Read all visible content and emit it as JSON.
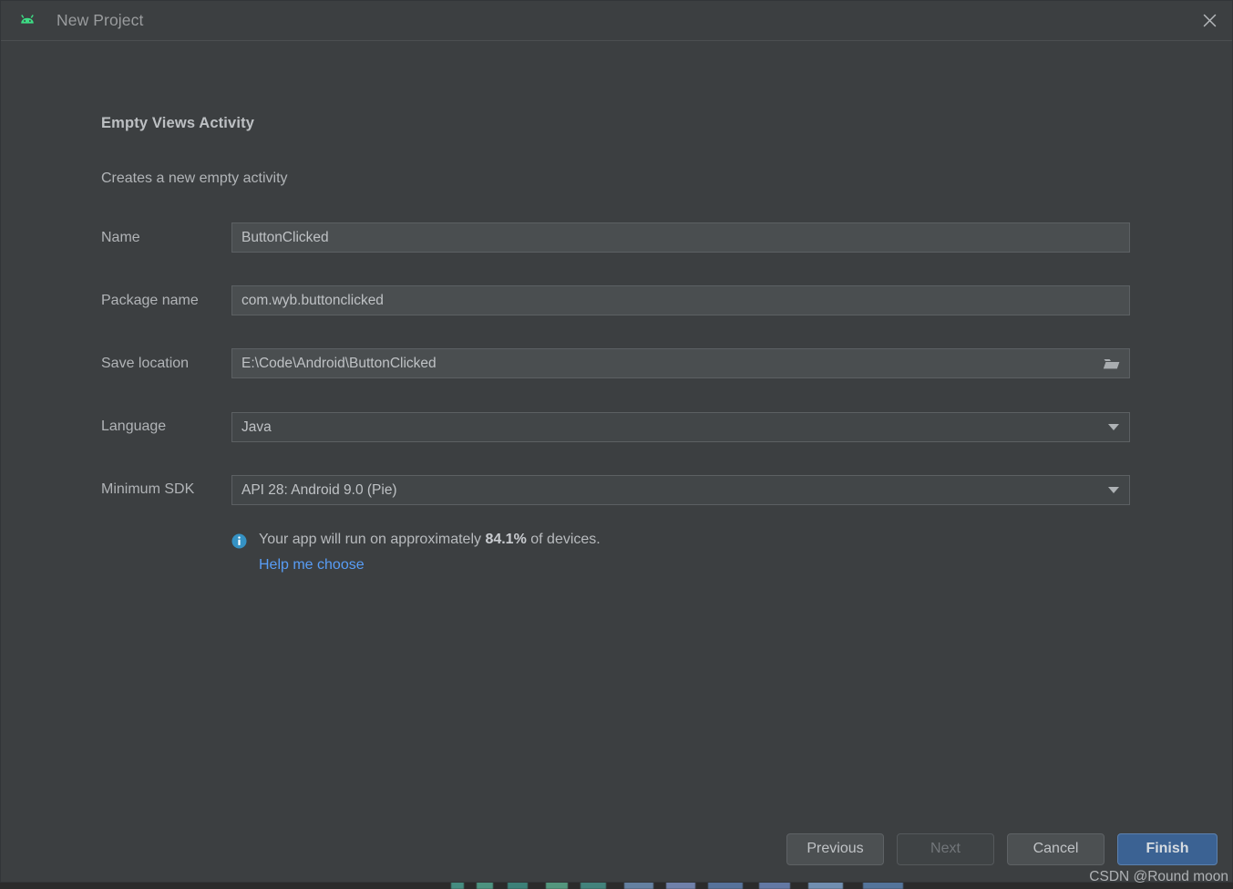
{
  "window": {
    "title": "New Project",
    "app_icon": "android-robot-icon",
    "close_icon": "close-icon",
    "accent_green": "#3ddc84",
    "accent_blue": "#3592c4",
    "primary_button_color": "#3b6293",
    "link_color": "#589df6"
  },
  "template": {
    "title": "Empty Views Activity",
    "description": "Creates a new empty activity"
  },
  "fields": [
    {
      "label": "Name",
      "value": "ButtonClicked",
      "type": "text",
      "name": "project-name"
    },
    {
      "label": "Package name",
      "value": "com.wyb.buttonclicked",
      "type": "text",
      "name": "package-name"
    },
    {
      "label": "Save location",
      "value": "E:\\Code\\Android\\ButtonClicked",
      "type": "text-browse",
      "name": "save-location",
      "trailing_icon": "folder-icon"
    },
    {
      "label": "Language",
      "value": "Java",
      "type": "combo",
      "name": "language",
      "trailing_icon": "chevron-down-icon"
    },
    {
      "label": "Minimum SDK",
      "value": "API 28: Android 9.0 (Pie)",
      "type": "combo",
      "name": "minimum-sdk",
      "trailing_icon": "chevron-down-icon"
    }
  ],
  "info": {
    "icon": "info-icon",
    "prefix": "Your app will run on approximately ",
    "percent": "84.1%",
    "suffix": " of devices.",
    "link": "Help me choose"
  },
  "footer": {
    "buttons": [
      {
        "label": "Previous",
        "state": "enabled",
        "name": "previous-button"
      },
      {
        "label": "Next",
        "state": "disabled",
        "name": "next-button"
      },
      {
        "label": "Cancel",
        "state": "enabled",
        "name": "cancel-button"
      },
      {
        "label": "Finish",
        "state": "primary",
        "name": "finish-button"
      }
    ],
    "watermark": "CSDN @Round moon"
  }
}
